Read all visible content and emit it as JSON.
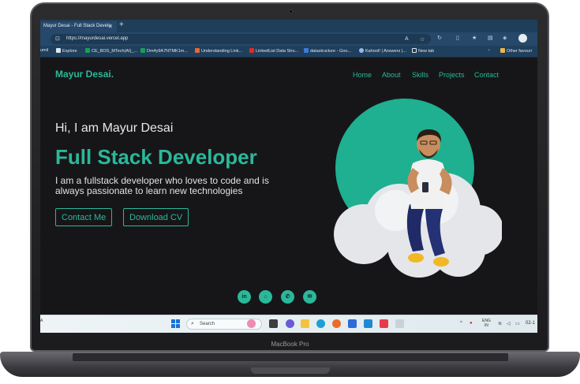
{
  "device": {
    "model": "MacBook Pro"
  },
  "browser": {
    "tab_title": "Mayur Desai - Full Stack Develo",
    "tab_close": "✕",
    "new_tab": "+",
    "url": "https://mayurdesai.vercel.app",
    "bookmarks": [
      {
        "label": "umil",
        "color": "#2a4f72"
      },
      {
        "label": "Explore",
        "color": "#dfe7ee"
      },
      {
        "label": "CE_BOS_MTech(AI)_...",
        "color": "#1a9e5a"
      },
      {
        "label": "Dm4y9A7NTMK1m...",
        "color": "#1a9e5a"
      },
      {
        "label": "Understanding Link...",
        "color": "#e0683a"
      },
      {
        "label": "LinkedList Data Stru...",
        "color": "#e02b2b"
      },
      {
        "label": "datastructure - Goo...",
        "color": "#3a7ae0"
      },
      {
        "label": "Kahoot! | Answers |...",
        "color": "#9bb7e8"
      },
      {
        "label": "New tab",
        "color": "#dfe7ee"
      },
      {
        "label": "Other favouri",
        "color": "#e8b84a"
      }
    ]
  },
  "site": {
    "logo": "Mayur Desai.",
    "nav": [
      "Home",
      "About",
      "Skills",
      "Projects",
      "Contact"
    ],
    "greeting": "Hi, I am Mayur Desai",
    "role": "Full Stack Developer",
    "description": "I am a fullstack developer who loves to code and is always passionate to learn new technologies",
    "buttons": {
      "contact": "Contact Me",
      "download": "Download CV"
    },
    "social": [
      {
        "name": "linkedin",
        "glyph": "in"
      },
      {
        "name": "github",
        "glyph": "⌂"
      },
      {
        "name": "whatsapp",
        "glyph": "✆"
      },
      {
        "name": "email",
        "glyph": "✉"
      }
    ],
    "colors": {
      "accent": "#2bb89a",
      "background": "#161618"
    }
  },
  "taskbar": {
    "search_placeholder": "Search",
    "lang_top": "ENG",
    "lang_bottom": "IN",
    "time_fragment": "02-1",
    "left_fragment": "A"
  }
}
